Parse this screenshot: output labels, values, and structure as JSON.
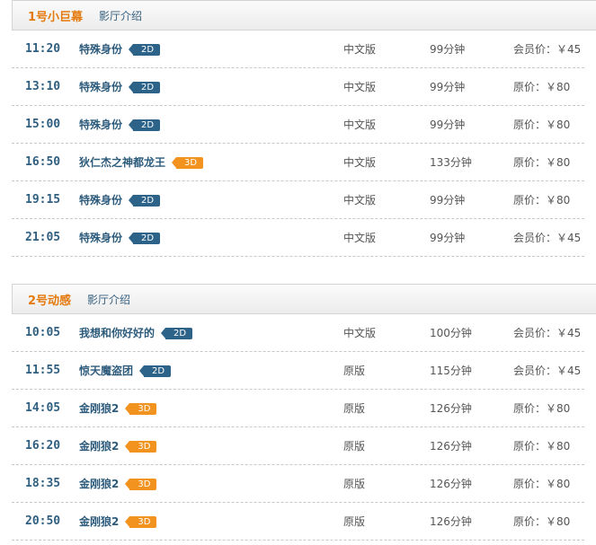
{
  "halls": [
    {
      "name": "1号小巨幕",
      "intro": "影厅介绍",
      "showings": [
        {
          "time": "11:20",
          "title": "特殊身份",
          "format": "2D",
          "lang": "中文版",
          "duration": "99分钟",
          "price": "会员价：￥45"
        },
        {
          "time": "13:10",
          "title": "特殊身份",
          "format": "2D",
          "lang": "中文版",
          "duration": "99分钟",
          "price": "原价：￥80"
        },
        {
          "time": "15:00",
          "title": "特殊身份",
          "format": "2D",
          "lang": "中文版",
          "duration": "99分钟",
          "price": "原价：￥80"
        },
        {
          "time": "16:50",
          "title": "狄仁杰之神都龙王",
          "format": "3D",
          "lang": "中文版",
          "duration": "133分钟",
          "price": "原价：￥80"
        },
        {
          "time": "19:15",
          "title": "特殊身份",
          "format": "2D",
          "lang": "中文版",
          "duration": "99分钟",
          "price": "原价：￥80"
        },
        {
          "time": "21:05",
          "title": "特殊身份",
          "format": "2D",
          "lang": "中文版",
          "duration": "99分钟",
          "price": "会员价：￥45"
        }
      ]
    },
    {
      "name": "2号动感",
      "intro": "影厅介绍",
      "showings": [
        {
          "time": "10:05",
          "title": "我想和你好好的",
          "format": "2D",
          "lang": "中文版",
          "duration": "100分钟",
          "price": "会员价：￥45"
        },
        {
          "time": "11:55",
          "title": "惊天魔盗团",
          "format": "2D",
          "lang": "原版",
          "duration": "115分钟",
          "price": "会员价：￥45"
        },
        {
          "time": "14:05",
          "title": "金刚狼2",
          "format": "3D",
          "lang": "原版",
          "duration": "126分钟",
          "price": "原价：￥80"
        },
        {
          "time": "16:20",
          "title": "金刚狼2",
          "format": "3D",
          "lang": "原版",
          "duration": "126分钟",
          "price": "原价：￥80"
        },
        {
          "time": "18:35",
          "title": "金刚狼2",
          "format": "3D",
          "lang": "原版",
          "duration": "126分钟",
          "price": "原价：￥80"
        },
        {
          "time": "20:50",
          "title": "金刚狼2",
          "format": "3D",
          "lang": "原版",
          "duration": "126分钟",
          "price": "原价：￥80"
        }
      ]
    }
  ],
  "colors": {
    "badge_2d": "#2d6389",
    "badge_3d": "#f2921f",
    "hall_name": "#e47a0c",
    "link": "#2d5b7c"
  }
}
